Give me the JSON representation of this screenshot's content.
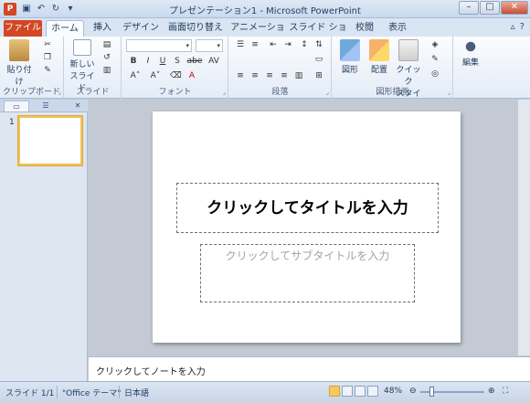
{
  "window": {
    "title": "プレゼンテーション1 - Microsoft PowerPoint",
    "app_icon_letter": "P",
    "controls": [
      "–",
      "□",
      "✕"
    ]
  },
  "tabs": [
    {
      "label": "ファイル"
    },
    {
      "label": "ホーム"
    },
    {
      "label": "挿入"
    },
    {
      "label": "デザイン"
    },
    {
      "label": "画面切り替え"
    },
    {
      "label": "アニメーション"
    },
    {
      "label": "スライド ショー"
    },
    {
      "label": "校閲"
    },
    {
      "label": "表示"
    }
  ],
  "ribbon": {
    "clipboard": {
      "label": "クリップボード",
      "paste": "貼り付け"
    },
    "slides": {
      "label": "スライド",
      "new_slide_line1": "新しい",
      "new_slide_line2": "スライド"
    },
    "font": {
      "label": "フォント",
      "styles": [
        "B",
        "I",
        "U",
        "S",
        "abe",
        "AV"
      ]
    },
    "paragraph": {
      "label": "段落"
    },
    "drawing": {
      "label": "図形描画",
      "shapes": "図形",
      "arrange": "配置",
      "quick_styles_line1": "クイック",
      "quick_styles_line2": "スタイル"
    },
    "editing": {
      "label": "編集"
    }
  },
  "leftpane": {
    "slide_number": "1"
  },
  "slide": {
    "title_placeholder": "クリックしてタイトルを入力",
    "subtitle_placeholder": "クリックしてサブタイトルを入力"
  },
  "notes": {
    "placeholder": "クリックしてノートを入力"
  },
  "statusbar": {
    "slide_info": "スライド 1/1",
    "theme": "\"Office テーマ\"",
    "language": "日本語",
    "zoom": "48%"
  },
  "colors": {
    "file_tab": "#d24726",
    "selected_thumb": "#f0c35a"
  }
}
